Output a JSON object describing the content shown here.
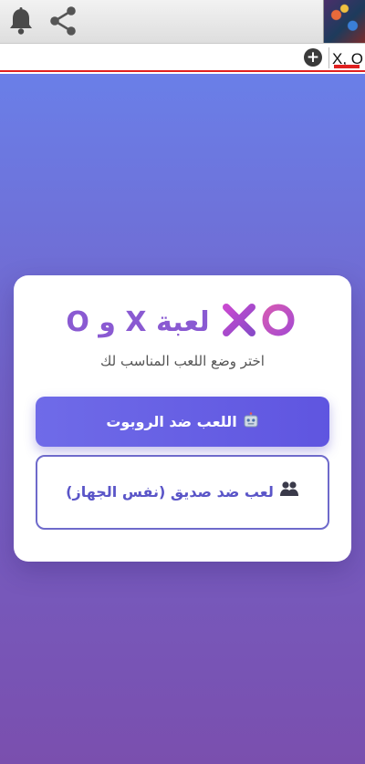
{
  "status_bar": {
    "icons": [
      "bell-icon",
      "share-icon"
    ],
    "thumbnail": "game-thumbnail"
  },
  "tabs": {
    "add_icon": "plus-circle-icon",
    "active_tab_label": "X, O"
  },
  "game_card": {
    "title": "لعبة X و O",
    "logo_icon": "xo-logo-icon",
    "subtitle": "اختر وضع اللعب المناسب لك",
    "robot_button_label": "اللعب ضد الروبوت",
    "robot_button_icon": "robot-icon",
    "friend_button_label": "لعب ضد صديق (نفس الجهاز)",
    "friend_button_icon": "two-people-icon"
  },
  "colors": {
    "accent": "#8a5ad2",
    "button_primary": "#6f6be8",
    "background_top": "#6a7fe8",
    "background_bottom": "#7a4fae",
    "tab_indicator": "#e02020"
  }
}
